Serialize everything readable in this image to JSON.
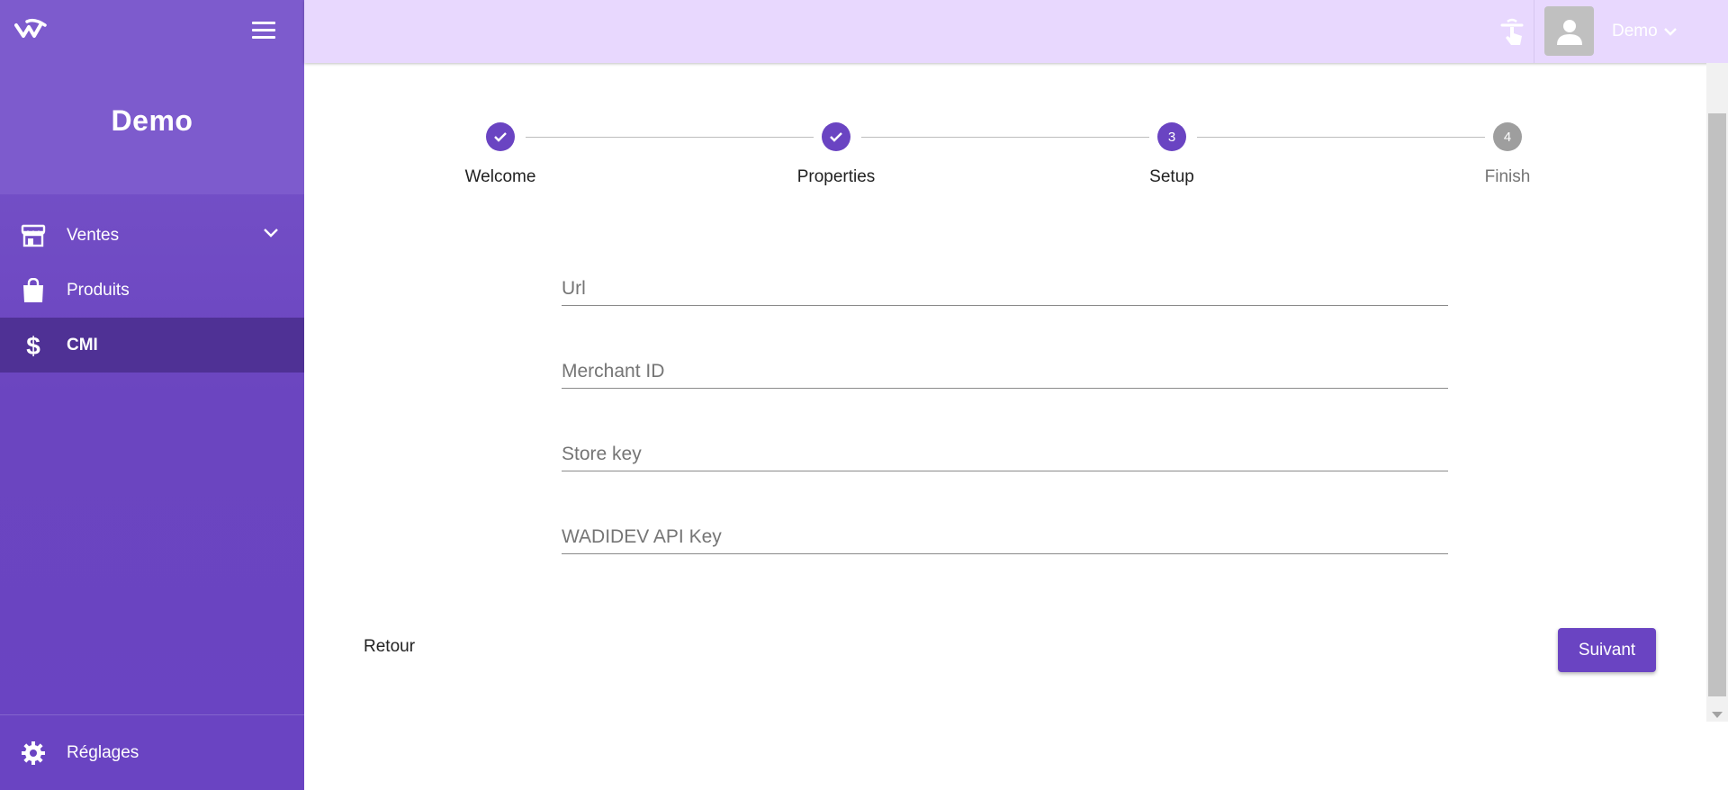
{
  "sidebar": {
    "title": "Demo",
    "items": [
      {
        "label": "Ventes",
        "icon": "store-icon",
        "expandable": true
      },
      {
        "label": "Produits",
        "icon": "shopping-bag-icon"
      },
      {
        "label": "CMI",
        "icon": "dollar-icon",
        "active": true
      }
    ],
    "footer": {
      "label": "Réglages",
      "icon": "gear-icon"
    }
  },
  "topbar": {
    "user_name": "Demo",
    "icons": [
      "tap-gesture-icon",
      "avatar-icon",
      "chevron-down-icon"
    ]
  },
  "stepper": {
    "steps": [
      {
        "label": "Welcome",
        "status": "done"
      },
      {
        "label": "Properties",
        "status": "done"
      },
      {
        "label": "Setup",
        "status": "current",
        "number": "3"
      },
      {
        "label": "Finish",
        "status": "pending",
        "number": "4"
      }
    ]
  },
  "form": {
    "fields": [
      {
        "placeholder": "Url",
        "value": ""
      },
      {
        "placeholder": "Merchant ID",
        "value": ""
      },
      {
        "placeholder": "Store key",
        "value": ""
      },
      {
        "placeholder": "WADIDEV API Key",
        "value": ""
      }
    ]
  },
  "actions": {
    "back_label": "Retour",
    "next_label": "Suivant"
  },
  "colors": {
    "primary": "#6a44c2",
    "sidebar_active": "#4f3195",
    "topbar": "#e8d8fe",
    "pending_step": "#9e9e9e"
  }
}
